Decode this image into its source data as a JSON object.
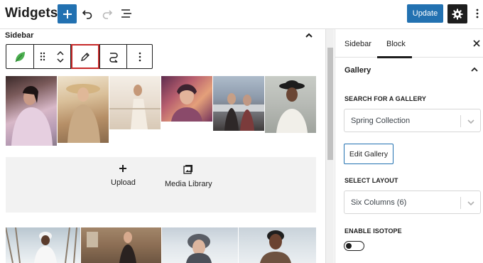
{
  "header": {
    "title": "Widgets",
    "add_icon": "plus-icon",
    "undo_icon": "undo-icon",
    "redo_icon": "redo-icon",
    "list_view_icon": "list-view-icon",
    "update_label": "Update",
    "settings_icon": "gear-icon",
    "more_icon": "more-vertical-icon"
  },
  "widget_area": {
    "label": "Sidebar",
    "collapse_icon": "chevron-up-icon"
  },
  "block_toolbar": {
    "block_icon": "leaf-icon",
    "drag_icon": "drag-handle-icon",
    "move_up_icon": "chevron-up-icon",
    "move_down_icon": "chevron-down-icon",
    "edit_icon": "pencil-icon",
    "transform_icon": "transform-icon",
    "options_icon": "more-vertical-icon"
  },
  "gallery": {
    "photos_row1": [
      "photo-1",
      "photo-2",
      "photo-3",
      "photo-4",
      "photo-5",
      "photo-6"
    ],
    "photos_row2": [
      "photo-7",
      "photo-8",
      "photo-9",
      "photo-10"
    ],
    "placeholder": {
      "upload_label": "Upload",
      "media_library_label": "Media Library"
    }
  },
  "settings": {
    "tabs": [
      "Sidebar",
      "Block"
    ],
    "active_tab": "Block",
    "panel_title": "Gallery",
    "search_label": "SEARCH FOR A GALLERY",
    "search_value": "Spring Collection",
    "edit_gallery_label": "Edit Gallery",
    "layout_label": "SELECT LAYOUT",
    "layout_value": "Six Columns (6)",
    "isotope_label": "ENABLE ISOTOPE",
    "isotope_enabled": false
  },
  "colors": {
    "accent": "#2271b1",
    "dark": "#1e1e1e",
    "highlight": "#c62828",
    "leaf": "#4caf50"
  }
}
